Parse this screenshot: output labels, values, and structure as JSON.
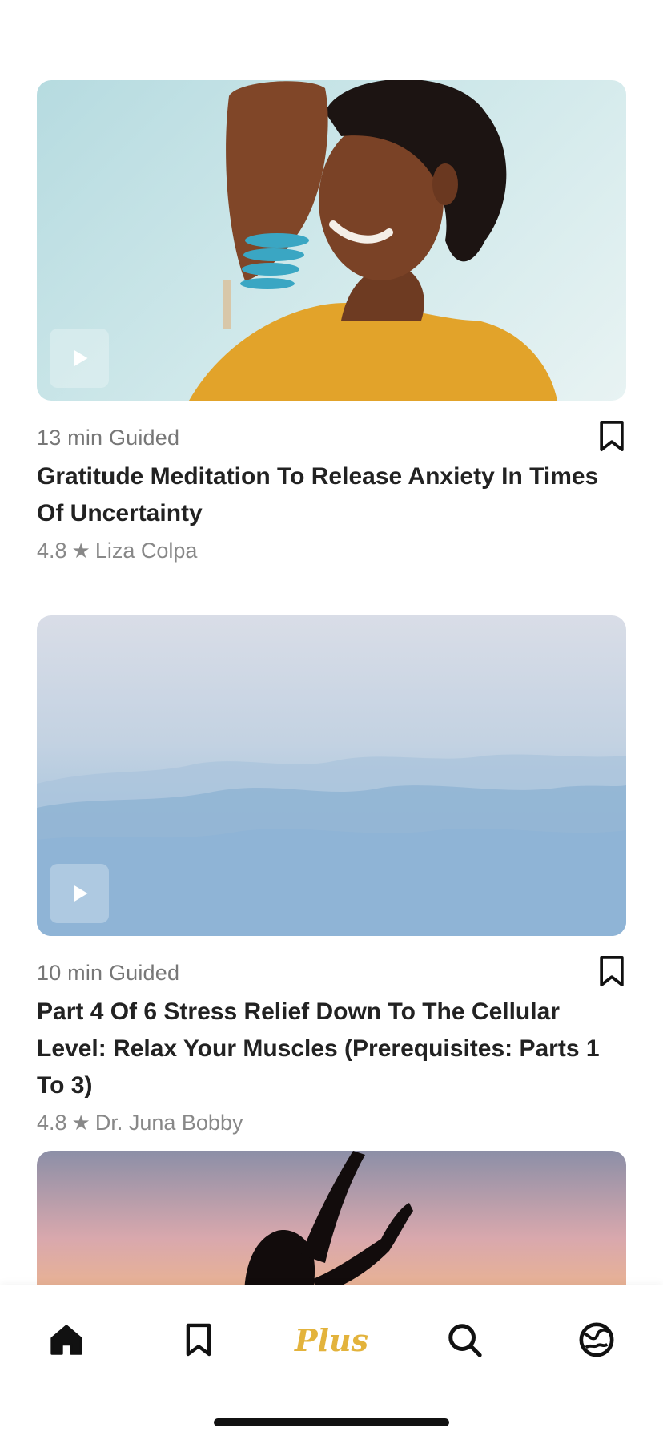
{
  "feed": {
    "items": [
      {
        "duration": "13 min Guided",
        "title": "Gratitude Meditation To Release Anxiety In Times Of Uncertainty",
        "rating": "4.8",
        "author": "Liza Colpa"
      },
      {
        "duration": "10 min Guided",
        "title": "Part 4 Of 6 Stress Relief Down To The Cellular Level: Relax Your Muscles (Prerequisites: Parts 1 To 3)",
        "rating": "4.8",
        "author": "Dr. Juna Bobby"
      }
    ]
  },
  "tabbar": {
    "plus_label": "Plus",
    "icons": [
      "home-icon",
      "bookmark-icon",
      "plus-label",
      "search-icon",
      "globe-icon"
    ]
  },
  "colors": {
    "accent": "#e3b33c",
    "text_primary": "#222222",
    "text_secondary": "#777777"
  }
}
